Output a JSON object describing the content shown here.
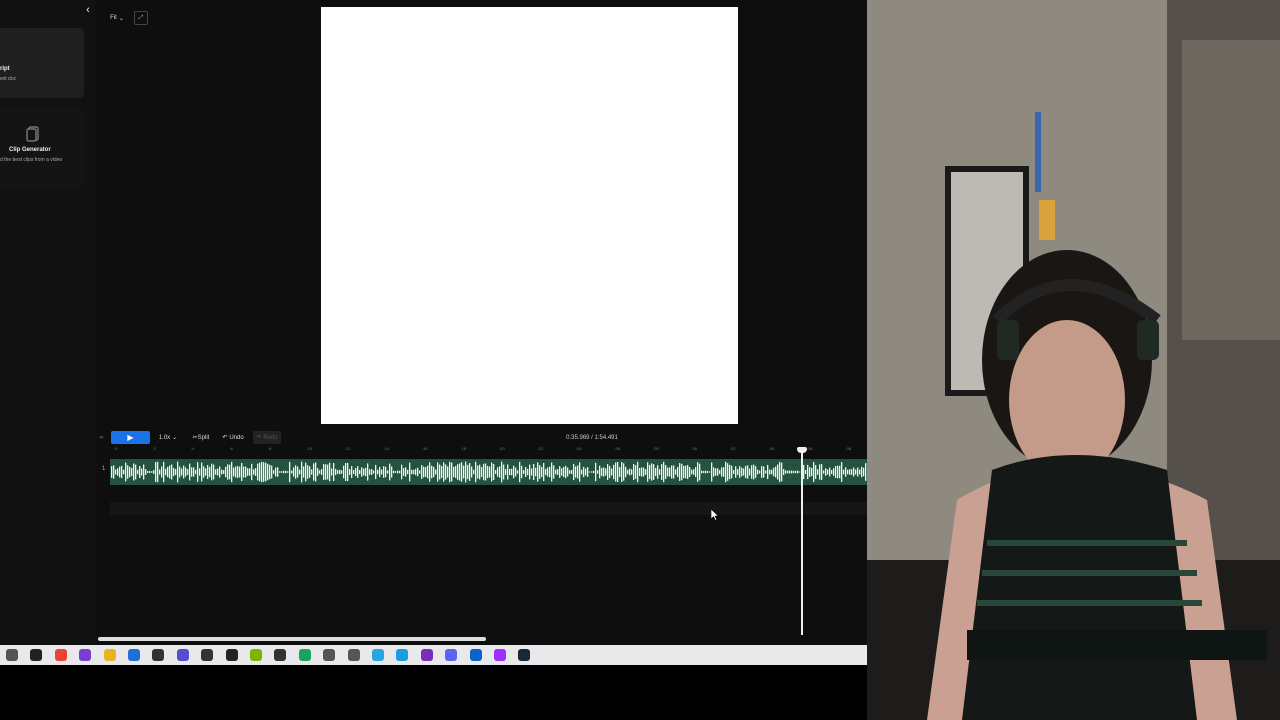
{
  "sidebar": {
    "script_card": {
      "title": "ript",
      "subtitle": "ext doc"
    },
    "clip_card": {
      "title": "Clip Generator",
      "subtitle": "d the best clips from a video"
    }
  },
  "viewer": {
    "fit_label": "Fit"
  },
  "toolbar": {
    "speed_label": "1.0x",
    "split_label": "Split",
    "undo_label": "Undo",
    "redo_label": "Redo",
    "time_readout": "0:35.969 / 1:54.491"
  },
  "timeline": {
    "track_number": "1",
    "ruler_ticks": [
      ":0",
      ":2",
      ":4",
      ":6",
      ":8",
      ":10",
      ":12",
      ":14",
      ":16",
      ":18",
      ":20",
      ":22",
      ":24",
      ":26",
      ":28",
      ":30",
      ":32",
      ":34",
      ":36",
      ":38"
    ],
    "playhead_seconds": 35.969,
    "duration_seconds": 114.491
  },
  "taskbar": {
    "icons": [
      {
        "name": "task-view-icon",
        "color": "#555555"
      },
      {
        "name": "alienware-icon",
        "color": "#222222"
      },
      {
        "name": "chrome-icon",
        "color": "#e84335"
      },
      {
        "name": "obs-icon",
        "color": "#7a3fd1"
      },
      {
        "name": "folder-icon",
        "color": "#e8b422"
      },
      {
        "name": "app-icon-blue",
        "color": "#1e6fd9"
      },
      {
        "name": "app-icon-dark",
        "color": "#333333"
      },
      {
        "name": "app-icon-purple",
        "color": "#5a4bd3"
      },
      {
        "name": "app-icon-alien",
        "color": "#333333"
      },
      {
        "name": "app-icon-a",
        "color": "#222222"
      },
      {
        "name": "nvidia-icon",
        "color": "#76b900"
      },
      {
        "name": "app-icon-circle",
        "color": "#333333"
      },
      {
        "name": "app-icon-green",
        "color": "#1aa260"
      },
      {
        "name": "app-icon-controller",
        "color": "#555555"
      },
      {
        "name": "app-icon-grid",
        "color": "#555555"
      },
      {
        "name": "app-icon-cyan",
        "color": "#28a7e0"
      },
      {
        "name": "edge-icon",
        "color": "#1b9de2"
      },
      {
        "name": "app-icon-violet",
        "color": "#7b2cbf"
      },
      {
        "name": "discord-icon",
        "color": "#5865f2"
      },
      {
        "name": "app-icon-blue-square",
        "color": "#0a63c9"
      },
      {
        "name": "app-icon-ring",
        "color": "#9b30ff"
      },
      {
        "name": "steam-icon",
        "color": "#1b2838"
      }
    ]
  },
  "colors": {
    "accent": "#1a73e8",
    "track": "#24523f"
  }
}
